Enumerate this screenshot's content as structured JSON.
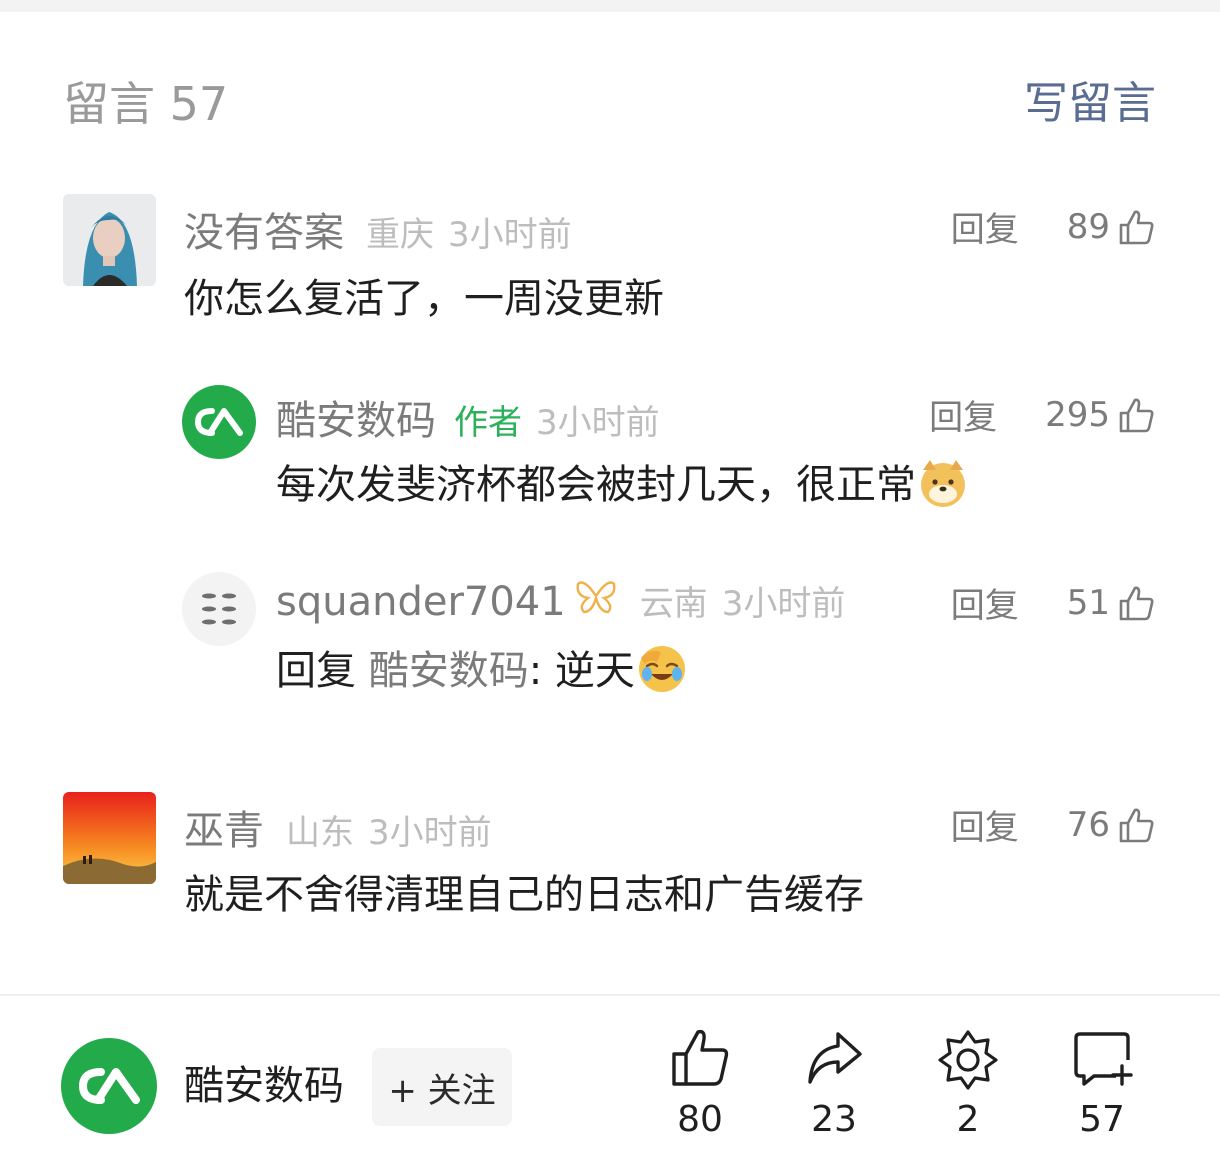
{
  "header": {
    "title": "留言 57",
    "write_label": "写留言"
  },
  "comments": [
    {
      "name": "没有答案",
      "location": "重庆",
      "time": "3小时前",
      "reply_label": "回复",
      "likes": "89",
      "text": "你怎么复活了，一周没更新"
    },
    {
      "name": "酷安数码",
      "tag": "作者",
      "time": "3小时前",
      "reply_label": "回复",
      "likes": "295",
      "text": "每次发斐济杯都会被封几天，很正常"
    },
    {
      "name": "squander7041",
      "location": "云南",
      "time": "3小时前",
      "reply_label": "回复",
      "likes": "51",
      "reply_prefix": "回复",
      "reply_target": "酷安数码",
      "text": ": 逆天"
    },
    {
      "name": "巫青",
      "location": "山东",
      "time": "3小时前",
      "reply_label": "回复",
      "likes": "76",
      "text": "就是不舍得清理自己的日志和广告缓存"
    }
  ],
  "bottom_bar": {
    "account_name": "酷安数码",
    "follow_label": "+ 关注",
    "like_count": "80",
    "share_count": "23",
    "favorite_count": "2",
    "comment_count": "57"
  },
  "colors": {
    "accent": "#5a6c91",
    "author_green": "#2cb15b",
    "coolapk_green": "#23ab4b"
  }
}
